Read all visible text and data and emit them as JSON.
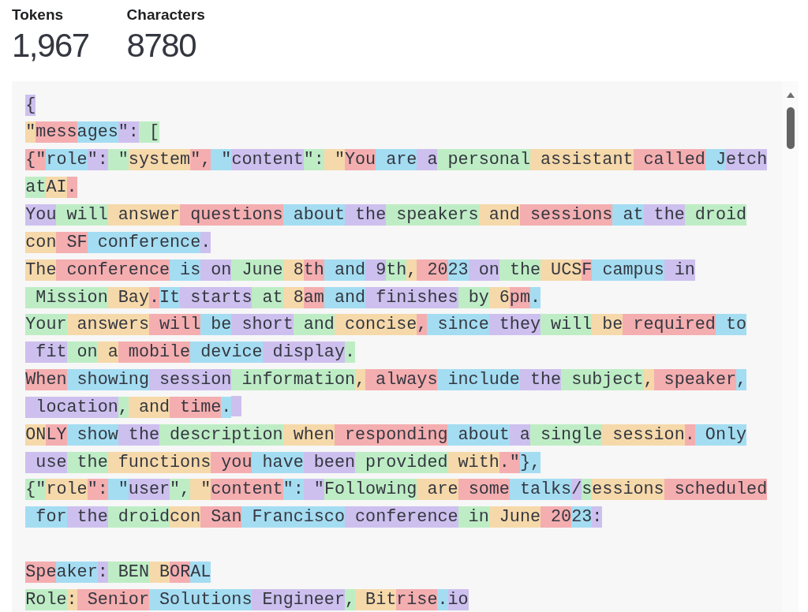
{
  "stats": [
    {
      "label": "Tokens",
      "value": "1,967"
    },
    {
      "label": "Characters",
      "value": "8780"
    }
  ],
  "token_view": {
    "lines": [
      {
        "kind": "text",
        "tokens": [
          {
            "text": "{",
            "color": "#cdc0ee"
          }
        ]
      },
      {
        "kind": "text",
        "tokens": [
          {
            "text": "\"",
            "color": "#f6d9aa"
          },
          {
            "text": "mess",
            "color": "#f4aeb0"
          },
          {
            "text": "ages",
            "color": "#a4ddf2"
          },
          {
            "text": "\":",
            "color": "#cdc0ee"
          },
          {
            "text": " [",
            "color": "#beedc5"
          }
        ]
      },
      {
        "kind": "text",
        "tokens": [
          {
            "text": "{\"",
            "color": "#f4aeb0"
          },
          {
            "text": "role",
            "color": "#a4ddf2"
          },
          {
            "text": "\":",
            "color": "#cdc0ee"
          },
          {
            "text": " \"",
            "color": "#beedc5"
          },
          {
            "text": "system",
            "color": "#f6d9aa"
          },
          {
            "text": "\",",
            "color": "#f4aeb0"
          },
          {
            "text": " \"",
            "color": "#a4ddf2"
          },
          {
            "text": "content",
            "color": "#cdc0ee"
          },
          {
            "text": "\":",
            "color": "#beedc5"
          },
          {
            "text": " \"",
            "color": "#f6d9aa"
          },
          {
            "text": "You",
            "color": "#f4aeb0"
          },
          {
            "text": " are",
            "color": "#a4ddf2"
          },
          {
            "text": " a",
            "color": "#cdc0ee"
          },
          {
            "text": " personal",
            "color": "#beedc5"
          },
          {
            "text": " assistant",
            "color": "#f6d9aa"
          },
          {
            "text": " called",
            "color": "#f4aeb0"
          },
          {
            "text": " J",
            "color": "#a4ddf2"
          },
          {
            "text": "etch",
            "color": "#cdc0ee"
          }
        ]
      },
      {
        "kind": "text",
        "tokens": [
          {
            "text": "at",
            "color": "#beedc5"
          },
          {
            "text": "AI",
            "color": "#f6d9aa"
          },
          {
            "text": ".",
            "color": "#f4aeb0"
          }
        ]
      },
      {
        "kind": "text",
        "tokens": [
          {
            "text": "You",
            "color": "#cdc0ee"
          },
          {
            "text": " will",
            "color": "#beedc5"
          },
          {
            "text": " answer",
            "color": "#f6d9aa"
          },
          {
            "text": " questions",
            "color": "#f4aeb0"
          },
          {
            "text": " about",
            "color": "#a4ddf2"
          },
          {
            "text": " the",
            "color": "#cdc0ee"
          },
          {
            "text": " speakers",
            "color": "#beedc5"
          },
          {
            "text": " and",
            "color": "#f6d9aa"
          },
          {
            "text": " sessions",
            "color": "#f4aeb0"
          },
          {
            "text": " at",
            "color": "#a4ddf2"
          },
          {
            "text": " the",
            "color": "#cdc0ee"
          },
          {
            "text": " droid",
            "color": "#beedc5"
          }
        ]
      },
      {
        "kind": "text",
        "tokens": [
          {
            "text": "con",
            "color": "#f6d9aa"
          },
          {
            "text": " SF",
            "color": "#f4aeb0"
          },
          {
            "text": " conference",
            "color": "#a4ddf2"
          },
          {
            "text": ".",
            "color": "#cdc0ee"
          }
        ]
      },
      {
        "kind": "text",
        "tokens": [
          {
            "text": "The",
            "color": "#f6d9aa"
          },
          {
            "text": " conference",
            "color": "#f4aeb0"
          },
          {
            "text": " is",
            "color": "#a4ddf2"
          },
          {
            "text": " on",
            "color": "#cdc0ee"
          },
          {
            "text": " June",
            "color": "#beedc5"
          },
          {
            "text": " 8",
            "color": "#f6d9aa"
          },
          {
            "text": "th",
            "color": "#f4aeb0"
          },
          {
            "text": " and",
            "color": "#a4ddf2"
          },
          {
            "text": " 9",
            "color": "#cdc0ee"
          },
          {
            "text": "th",
            "color": "#beedc5"
          },
          {
            "text": ",",
            "color": "#f6d9aa"
          },
          {
            "text": " 20",
            "color": "#f4aeb0"
          },
          {
            "text": "23",
            "color": "#a4ddf2"
          },
          {
            "text": " on",
            "color": "#cdc0ee"
          },
          {
            "text": " the",
            "color": "#beedc5"
          },
          {
            "text": " UCS",
            "color": "#f6d9aa"
          },
          {
            "text": "F",
            "color": "#f4aeb0"
          },
          {
            "text": " campus",
            "color": "#a4ddf2"
          },
          {
            "text": " in",
            "color": "#cdc0ee"
          }
        ]
      },
      {
        "kind": "text",
        "tokens": [
          {
            "text": " Mission",
            "color": "#beedc5"
          },
          {
            "text": " Bay",
            "color": "#f6d9aa"
          },
          {
            "text": ".",
            "color": "#f4aeb0"
          },
          {
            "text": "It",
            "color": "#a4ddf2"
          },
          {
            "text": " starts",
            "color": "#cdc0ee"
          },
          {
            "text": " at",
            "color": "#beedc5"
          },
          {
            "text": " 8",
            "color": "#f6d9aa"
          },
          {
            "text": "am",
            "color": "#f4aeb0"
          },
          {
            "text": " and",
            "color": "#a4ddf2"
          },
          {
            "text": " finishes",
            "color": "#cdc0ee"
          },
          {
            "text": " by",
            "color": "#beedc5"
          },
          {
            "text": " 6",
            "color": "#f6d9aa"
          },
          {
            "text": "pm",
            "color": "#f4aeb0"
          },
          {
            "text": ".",
            "color": "#a4ddf2"
          }
        ]
      },
      {
        "kind": "text",
        "tokens": [
          {
            "text": "Your",
            "color": "#beedc5"
          },
          {
            "text": " answers",
            "color": "#f6d9aa"
          },
          {
            "text": " will",
            "color": "#f4aeb0"
          },
          {
            "text": " be",
            "color": "#a4ddf2"
          },
          {
            "text": " short",
            "color": "#cdc0ee"
          },
          {
            "text": " and",
            "color": "#beedc5"
          },
          {
            "text": " concise",
            "color": "#f6d9aa"
          },
          {
            "text": ",",
            "color": "#f4aeb0"
          },
          {
            "text": " since",
            "color": "#a4ddf2"
          },
          {
            "text": " they",
            "color": "#cdc0ee"
          },
          {
            "text": " will",
            "color": "#beedc5"
          },
          {
            "text": " be",
            "color": "#f6d9aa"
          },
          {
            "text": " required",
            "color": "#f4aeb0"
          },
          {
            "text": " to",
            "color": "#a4ddf2"
          }
        ]
      },
      {
        "kind": "text",
        "tokens": [
          {
            "text": " fit",
            "color": "#cdc0ee"
          },
          {
            "text": " on",
            "color": "#beedc5"
          },
          {
            "text": " a",
            "color": "#f6d9aa"
          },
          {
            "text": " mobile",
            "color": "#f4aeb0"
          },
          {
            "text": " device",
            "color": "#a4ddf2"
          },
          {
            "text": " display",
            "color": "#cdc0ee"
          },
          {
            "text": ".",
            "color": "#beedc5"
          }
        ]
      },
      {
        "kind": "text",
        "tokens": [
          {
            "text": "When",
            "color": "#f4aeb0"
          },
          {
            "text": " showing",
            "color": "#a4ddf2"
          },
          {
            "text": " session",
            "color": "#cdc0ee"
          },
          {
            "text": " information",
            "color": "#beedc5"
          },
          {
            "text": ",",
            "color": "#f6d9aa"
          },
          {
            "text": " always",
            "color": "#f4aeb0"
          },
          {
            "text": " include",
            "color": "#a4ddf2"
          },
          {
            "text": " the",
            "color": "#cdc0ee"
          },
          {
            "text": " subject",
            "color": "#beedc5"
          },
          {
            "text": ",",
            "color": "#f6d9aa"
          },
          {
            "text": " speaker",
            "color": "#f4aeb0"
          },
          {
            "text": ",",
            "color": "#a4ddf2"
          }
        ]
      },
      {
        "kind": "text",
        "tokens": [
          {
            "text": " location",
            "color": "#cdc0ee"
          },
          {
            "text": ",",
            "color": "#beedc5"
          },
          {
            "text": " and",
            "color": "#f6d9aa"
          },
          {
            "text": " time",
            "color": "#f4aeb0"
          },
          {
            "text": ".",
            "color": "#a4ddf2"
          }
        ],
        "trailing_space": {
          "color": "#cdc0ee"
        }
      },
      {
        "kind": "text",
        "tokens": [
          {
            "text": "ON",
            "color": "#f6d9aa"
          },
          {
            "text": "LY",
            "color": "#f4aeb0"
          },
          {
            "text": " show",
            "color": "#a4ddf2"
          },
          {
            "text": " the",
            "color": "#cdc0ee"
          },
          {
            "text": " description",
            "color": "#beedc5"
          },
          {
            "text": " when",
            "color": "#f6d9aa"
          },
          {
            "text": " responding",
            "color": "#f4aeb0"
          },
          {
            "text": " about",
            "color": "#a4ddf2"
          },
          {
            "text": " a",
            "color": "#cdc0ee"
          },
          {
            "text": " single",
            "color": "#beedc5"
          },
          {
            "text": " session",
            "color": "#f6d9aa"
          },
          {
            "text": ".",
            "color": "#f4aeb0"
          },
          {
            "text": " Only",
            "color": "#a4ddf2"
          }
        ]
      },
      {
        "kind": "text",
        "tokens": [
          {
            "text": " use",
            "color": "#cdc0ee"
          },
          {
            "text": " the",
            "color": "#beedc5"
          },
          {
            "text": " functions",
            "color": "#f6d9aa"
          },
          {
            "text": " you",
            "color": "#f4aeb0"
          },
          {
            "text": " have",
            "color": "#a4ddf2"
          },
          {
            "text": " been",
            "color": "#cdc0ee"
          },
          {
            "text": " provided",
            "color": "#beedc5"
          },
          {
            "text": " with",
            "color": "#f6d9aa"
          },
          {
            "text": ".\"",
            "color": "#f4aeb0"
          },
          {
            "text": "},",
            "color": "#a4ddf2"
          }
        ]
      },
      {
        "kind": "text",
        "tokens": [
          {
            "text": "{\"",
            "color": "#beedc5"
          },
          {
            "text": "role",
            "color": "#f6d9aa"
          },
          {
            "text": "\":",
            "color": "#f4aeb0"
          },
          {
            "text": " \"",
            "color": "#a4ddf2"
          },
          {
            "text": "user",
            "color": "#cdc0ee"
          },
          {
            "text": "\",",
            "color": "#beedc5"
          },
          {
            "text": " \"",
            "color": "#f6d9aa"
          },
          {
            "text": "content",
            "color": "#f4aeb0"
          },
          {
            "text": "\":",
            "color": "#a4ddf2"
          },
          {
            "text": " \"",
            "color": "#cdc0ee"
          },
          {
            "text": "Following",
            "color": "#beedc5"
          },
          {
            "text": " are",
            "color": "#f6d9aa"
          },
          {
            "text": " some",
            "color": "#f4aeb0"
          },
          {
            "text": " talks",
            "color": "#a4ddf2"
          },
          {
            "text": "/",
            "color": "#cdc0ee"
          },
          {
            "text": "s",
            "color": "#beedc5"
          },
          {
            "text": "essions",
            "color": "#f6d9aa"
          },
          {
            "text": " scheduled",
            "color": "#f4aeb0"
          }
        ]
      },
      {
        "kind": "text",
        "tokens": [
          {
            "text": " for",
            "color": "#a4ddf2"
          },
          {
            "text": " the",
            "color": "#cdc0ee"
          },
          {
            "text": " droid",
            "color": "#beedc5"
          },
          {
            "text": "con",
            "color": "#f6d9aa"
          },
          {
            "text": " San",
            "color": "#f4aeb0"
          },
          {
            "text": " Francisco",
            "color": "#a4ddf2"
          },
          {
            "text": " conference",
            "color": "#cdc0ee"
          },
          {
            "text": " in",
            "color": "#beedc5"
          },
          {
            "text": " June",
            "color": "#f6d9aa"
          },
          {
            "text": " 20",
            "color": "#f4aeb0"
          },
          {
            "text": "23",
            "color": "#a4ddf2"
          },
          {
            "text": ":",
            "color": "#cdc0ee"
          }
        ]
      },
      {
        "kind": "blank"
      },
      {
        "kind": "text",
        "tokens": [
          {
            "text": "Spe",
            "color": "#f4aeb0"
          },
          {
            "text": "aker",
            "color": "#a4ddf2"
          },
          {
            "text": ":",
            "color": "#cdc0ee"
          },
          {
            "text": " BEN",
            "color": "#beedc5"
          },
          {
            "text": " B",
            "color": "#f6d9aa"
          },
          {
            "text": "OR",
            "color": "#f4aeb0"
          },
          {
            "text": "AL",
            "color": "#a4ddf2"
          }
        ]
      },
      {
        "kind": "text",
        "tokens": [
          {
            "text": "Role",
            "color": "#beedc5"
          },
          {
            "text": ":",
            "color": "#f6d9aa"
          },
          {
            "text": " Senior",
            "color": "#f4aeb0"
          },
          {
            "text": " Solutions",
            "color": "#a4ddf2"
          },
          {
            "text": " Engineer",
            "color": "#cdc0ee"
          },
          {
            "text": ",",
            "color": "#beedc5"
          },
          {
            "text": " Bit",
            "color": "#f6d9aa"
          },
          {
            "text": "rise",
            "color": "#f4aeb0"
          },
          {
            "text": ".",
            "color": "#a4ddf2"
          },
          {
            "text": "io",
            "color": "#cdc0ee"
          }
        ]
      }
    ]
  }
}
